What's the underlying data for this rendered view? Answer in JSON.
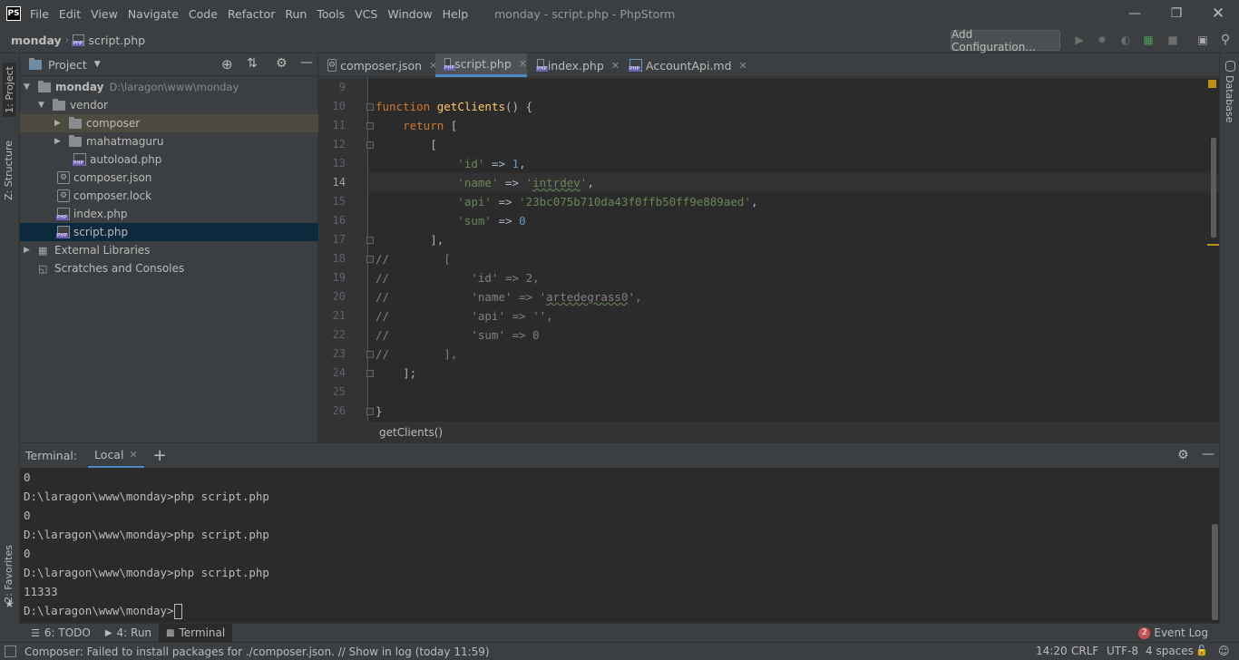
{
  "menubar": {
    "logo": "PS",
    "items": [
      "File",
      "Edit",
      "View",
      "Navigate",
      "Code",
      "Refactor",
      "Run",
      "Tools",
      "VCS",
      "Window",
      "Help"
    ],
    "title": "monday - script.php - PhpStorm"
  },
  "navbar": {
    "project": "monday",
    "file": "script.php",
    "add_config": "Add Configuration..."
  },
  "left_strip": {
    "project_tab": "1: Project",
    "structure_tab": "Z: Structure",
    "favorites_tab": "2: Favorites"
  },
  "right_strip": {
    "database_tab": "Database"
  },
  "project_panel": {
    "title": "Project",
    "root_name": "monday",
    "root_path": "D:\\laragon\\www\\monday",
    "vendor": "vendor",
    "composer_dir": "composer",
    "mahatmaguru": "mahatmaguru",
    "autoload": "autoload.php",
    "composer_json": "composer.json",
    "composer_lock": "composer.lock",
    "index_php": "index.php",
    "script_php": "script.php",
    "external_libraries": "External Libraries",
    "scratches": "Scratches and Consoles"
  },
  "tabs": [
    {
      "label": "composer.json"
    },
    {
      "label": "script.php"
    },
    {
      "label": "index.php"
    },
    {
      "label": "AccountApi.md"
    }
  ],
  "editor": {
    "line_numbers": [
      "9",
      "10",
      "11",
      "12",
      "13",
      "14",
      "15",
      "16",
      "17",
      "18",
      "19",
      "20",
      "21",
      "22",
      "23",
      "24",
      "25",
      "26"
    ],
    "breadcrumb": "getClients()"
  },
  "terminal": {
    "label": "Terminal:",
    "tab": "Local",
    "lines": [
      "0",
      "D:\\laragon\\www\\monday>php script.php",
      "0",
      "D:\\laragon\\www\\monday>php script.php",
      "0",
      "D:\\laragon\\www\\monday>php script.php",
      "11333",
      "D:\\laragon\\www\\monday>"
    ]
  },
  "tool_tabs": {
    "todo": "6: TODO",
    "run": "4: Run",
    "terminal": "Terminal",
    "event_log": "Event Log",
    "event_count": "2"
  },
  "status": {
    "message": "Composer: Failed to install packages for  ./composer.json. // Show in log (today 11:59)",
    "position": "14:20",
    "line_sep": "CRLF",
    "encoding": "UTF-8",
    "indent": "4 spaces"
  },
  "colors": {
    "accent": "#4a88c7",
    "keyword": "#cc7832",
    "string": "#6a8759",
    "number": "#6897bb",
    "function": "#ffc66d"
  }
}
